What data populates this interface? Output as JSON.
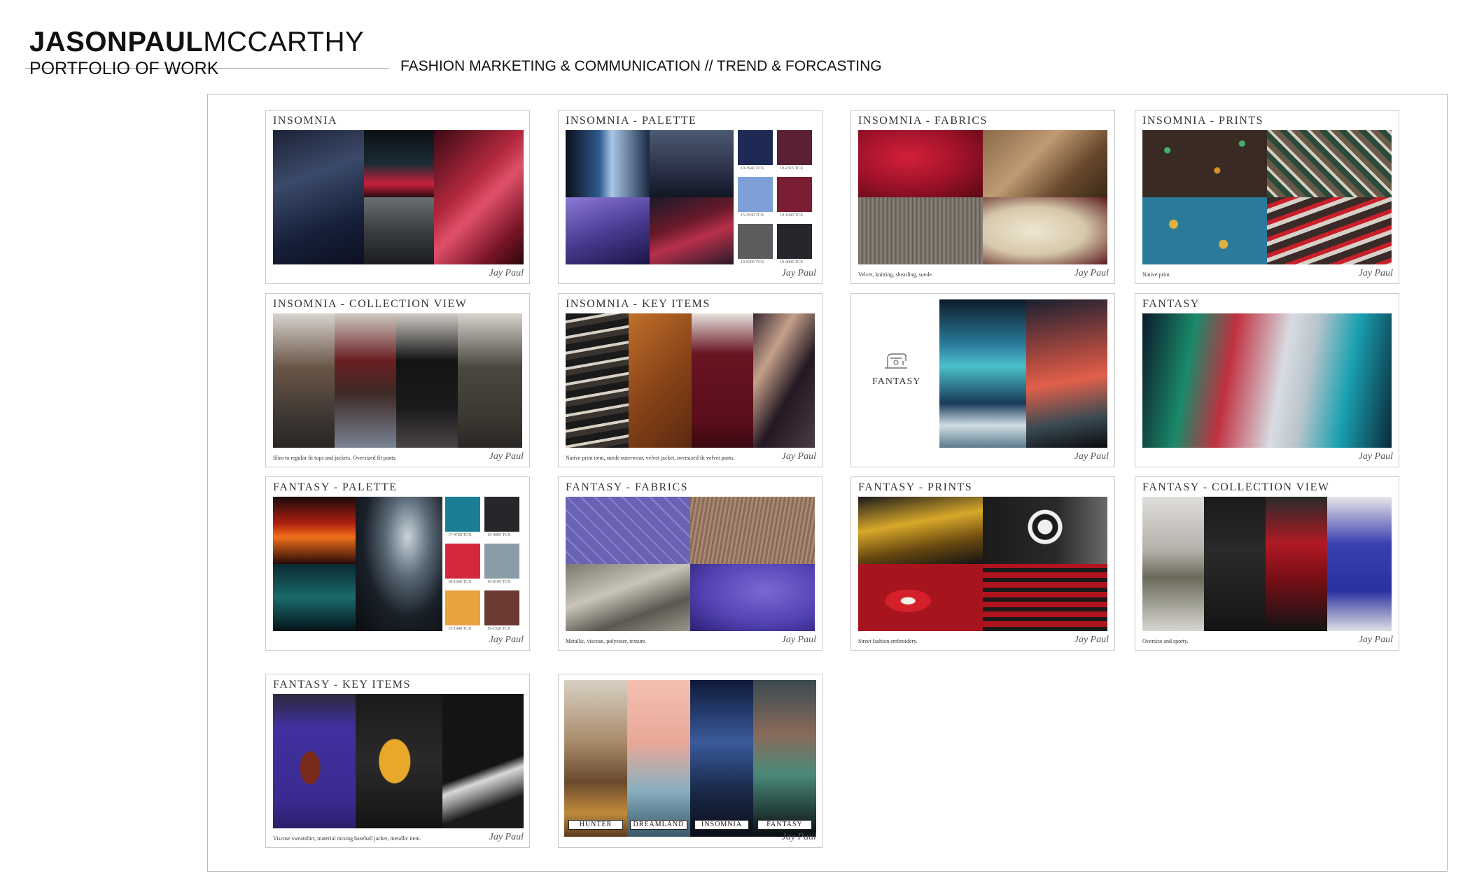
{
  "header": {
    "name_bold": "JASONPAUL",
    "name_light": "MCCARTHY",
    "subtitle": "PORTFOLIO OF WORK",
    "tagline": "FASHION MARKETING & COMMUNICATION // TREND & FORCASTING"
  },
  "boards": {
    "insomnia": {
      "title": "INSOMNIA"
    },
    "insomnia_palette": {
      "title": "INSOMNIA - PALETTE",
      "swatches": [
        {
          "code": "19-3940 TCX",
          "color": "#1e2a55"
        },
        {
          "code": "19-2315 TCX",
          "color": "#5a2136"
        },
        {
          "code": "15-3930 TCX",
          "color": "#7ea0d6"
        },
        {
          "code": "19-1943 TCX",
          "color": "#7a1e34"
        },
        {
          "code": "18-0306 TCX",
          "color": "#5c5c5e"
        },
        {
          "code": "19-4005 TCX",
          "color": "#26262c"
        }
      ]
    },
    "insomnia_fabrics": {
      "title": "INSOMNIA - FABRICS",
      "caption": "Velvet, knitting, shearling, suede."
    },
    "insomnia_prints": {
      "title": "INSOMNIA - PRINTS",
      "caption": "Native print."
    },
    "insomnia_collection": {
      "title": "INSOMNIA - COLLECTION VIEW",
      "caption": "Slim to regular fit tops and jackets. Oversized fit pants."
    },
    "insomnia_key_items": {
      "title": "INSOMNIA - KEY ITEMS",
      "caption": "Native print item, suede outerwear, velvet jacket, oversized fit velvet pants."
    },
    "fantasy_intro": {
      "word": "FANTASY"
    },
    "fantasy": {
      "title": "FANTASY"
    },
    "fantasy_palette": {
      "title": "FANTASY - PALETTE",
      "swatches": [
        {
          "code": "17-4728 TCX",
          "color": "#1a7f95"
        },
        {
          "code": "19-4005 TCX",
          "color": "#26262b"
        },
        {
          "code": "18-1660 TCX",
          "color": "#d4283c"
        },
        {
          "code": "16-4109 TCX",
          "color": "#8a9ca6"
        },
        {
          "code": "15-1049 TCX",
          "color": "#e8a23e"
        },
        {
          "code": "19-1320 TCX",
          "color": "#6a3a33"
        }
      ]
    },
    "fantasy_fabrics": {
      "title": "FANTASY - FABRICS",
      "caption": "Metallic, viscose, polyester, texture."
    },
    "fantasy_prints": {
      "title": "FANTASY - PRINTS",
      "caption": "Street fashion embroidery."
    },
    "fantasy_collection": {
      "title": "FANTASY - COLLECTION VIEW",
      "caption": "Oversize and sporty."
    },
    "fantasy_key_items": {
      "title": "FANTASY - KEY ITEMS",
      "caption": "Viscose sweatshirt, material mixing baseball jacket, metallic item."
    },
    "themes": {
      "labels": [
        "HUNTER",
        "DREAMLAND",
        "INSOMNIA",
        "FANTASY"
      ]
    }
  },
  "signature": "Jay Paul"
}
